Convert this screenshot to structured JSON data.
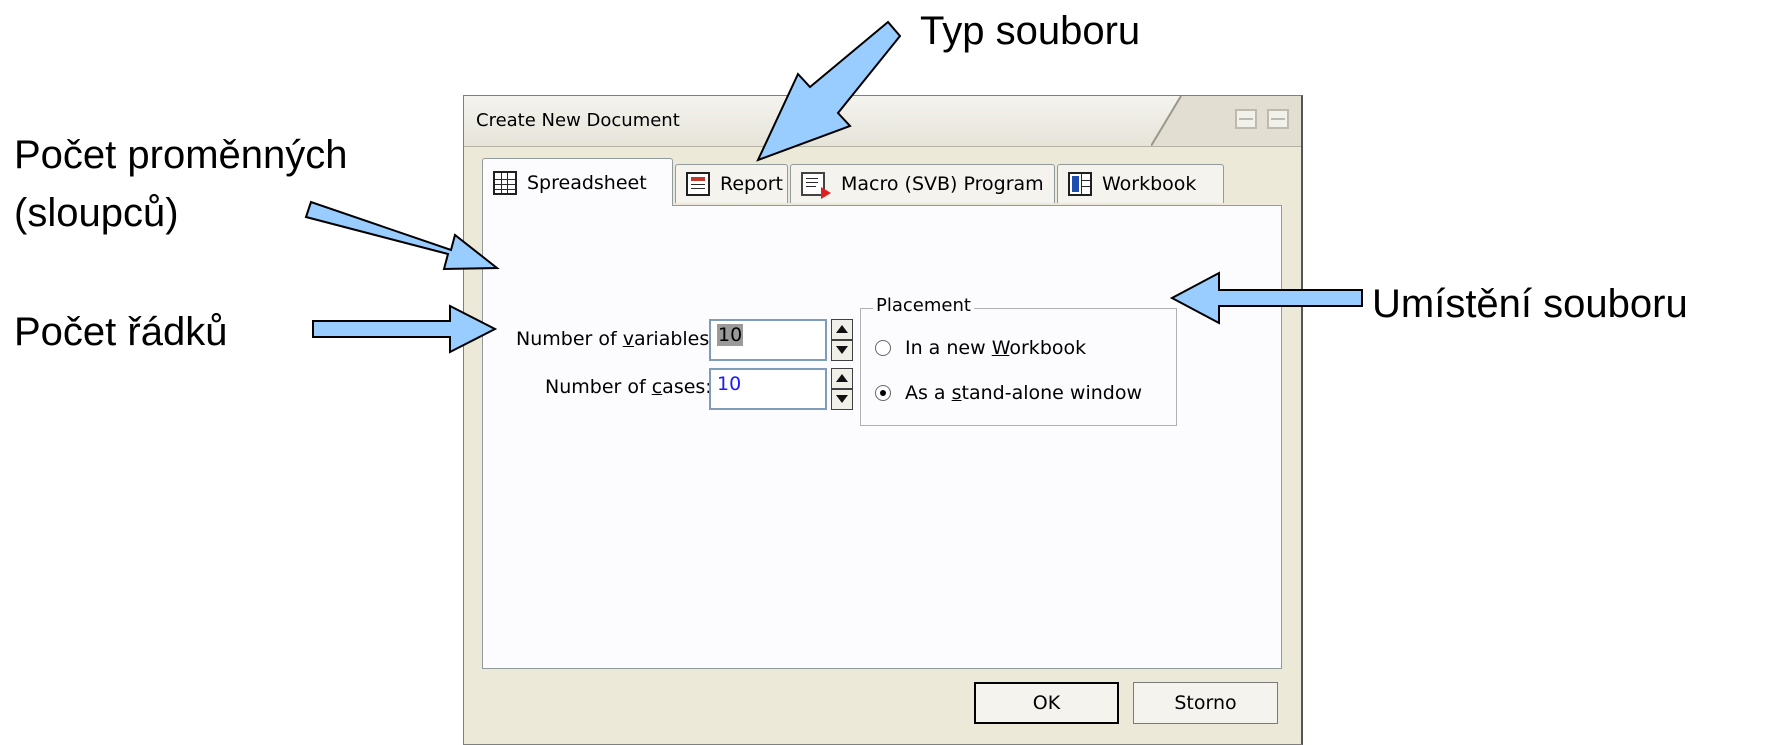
{
  "annotations": {
    "file_type": "Typ souboru",
    "variables_line1": "Počet proměnných",
    "variables_line2": "(sloupců)",
    "rows": "Počet řádků",
    "placement": "Umístění souboru"
  },
  "dialog": {
    "title": "Create New Document",
    "tabs": [
      {
        "label": "Spreadsheet",
        "icon": "spreadsheet-icon",
        "active": true
      },
      {
        "label": "Report",
        "icon": "report-icon",
        "active": false
      },
      {
        "label": "Macro (SVB) Program",
        "icon": "macro-icon",
        "active": false
      },
      {
        "label": "Workbook",
        "icon": "workbook-icon",
        "active": false
      }
    ],
    "variables": {
      "label_pre": "Number of ",
      "label_key": "v",
      "label_post": "ariables:",
      "value": "10"
    },
    "cases": {
      "label_pre": "Number of ",
      "label_key": "c",
      "label_post": "ases:",
      "value": "10"
    },
    "placement": {
      "legend": "Placement",
      "options": [
        {
          "pre": "In a new ",
          "key": "W",
          "post": "orkbook",
          "checked": false
        },
        {
          "pre": "As a ",
          "key": "s",
          "post": "tand-alone window",
          "checked": true
        }
      ]
    },
    "buttons": {
      "ok": "OK",
      "cancel": "Storno"
    }
  },
  "colors": {
    "arrow_fill": "#99ccff",
    "arrow_stroke": "#000000",
    "dialog_bg": "#ece9d8",
    "panel_bg": "#fcfcfe"
  }
}
